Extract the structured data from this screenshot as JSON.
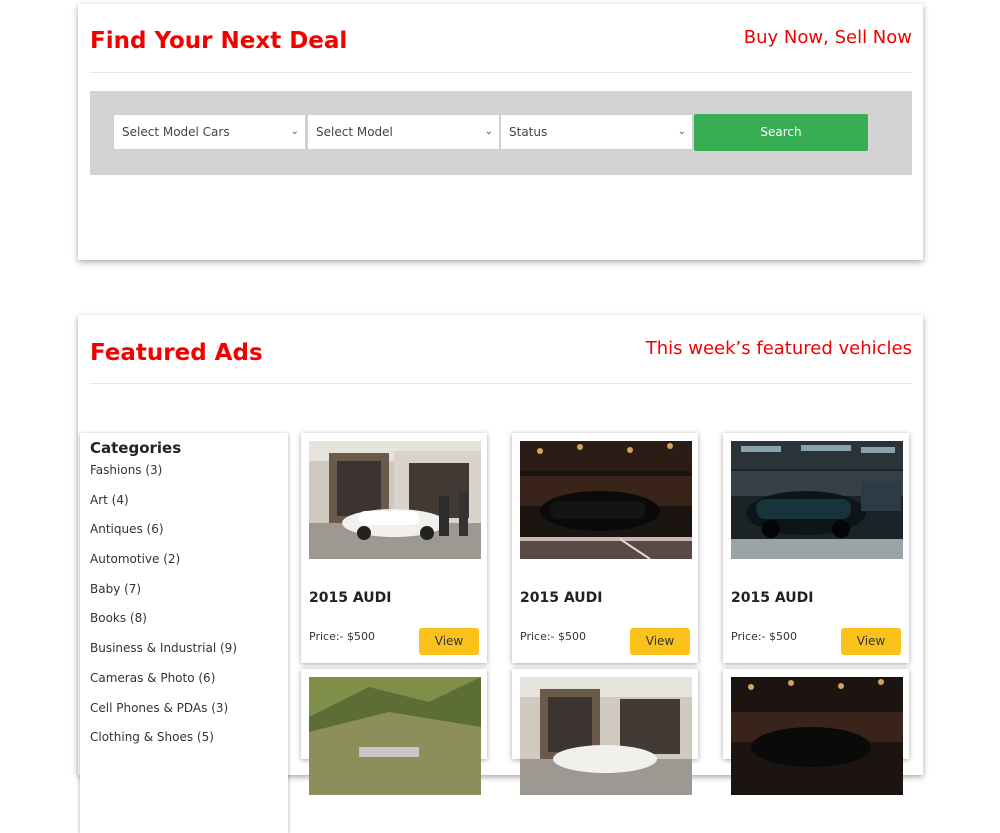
{
  "top_panel": {
    "title": "Find Your Next Deal",
    "tagline": "Buy Now, Sell Now",
    "search": {
      "select_model_cars": "Select Model Cars",
      "select_model": "Select Model",
      "status": "Status",
      "search_button": "Search"
    }
  },
  "featured_panel": {
    "title": "Featured Ads",
    "tagline": "This week’s featured vehicles",
    "categories_title": "Categories",
    "categories": [
      "Fashions (3)",
      "Art (4)",
      "Antiques (6)",
      "Automotive (2)",
      "Baby (7)",
      "Books (8)",
      "Business & Industrial (9)",
      "Cameras & Photo (6)",
      "Cell Phones & PDAs (3)",
      "Clothing & Shoes (5)"
    ],
    "cards": [
      {
        "title": "2015 AUDI",
        "price": "Price:- $500",
        "button": "View"
      },
      {
        "title": "2015 AUDI",
        "price": "Price:- $500",
        "button": "View"
      },
      {
        "title": "2015 AUDI",
        "price": "Price:- $500",
        "button": "View"
      }
    ]
  },
  "colors": {
    "accent_red": "#f20000",
    "search_green": "#37ae54",
    "view_yellow": "#fbc21b",
    "search_bar_gray": "#d3d3d3"
  }
}
